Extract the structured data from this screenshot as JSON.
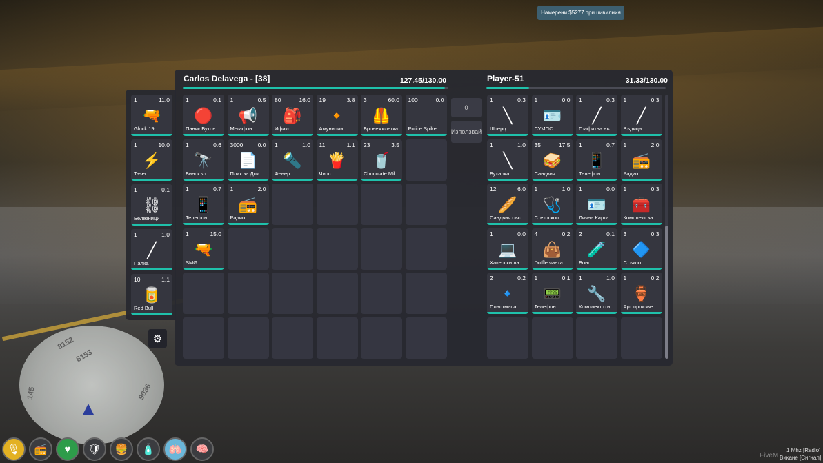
{
  "notification": "Намерени $5277 при цивилния",
  "left_inventory": {
    "title": "Carlos Delavega - [38]",
    "weight": "127.45/130.00",
    "hotbar": [
      {
        "amount": "1",
        "weight": "11.0",
        "label": "Glock 19",
        "icon": "pistol-icon",
        "glyph": "🔫"
      },
      {
        "amount": "1",
        "weight": "10.0",
        "label": "Taser",
        "icon": "taser-icon",
        "glyph": "⚡"
      },
      {
        "amount": "1",
        "weight": "0.1",
        "label": "Белезници",
        "icon": "handcuffs-icon",
        "glyph": "⛓"
      },
      {
        "amount": "1",
        "weight": "1.0",
        "label": "Палка",
        "icon": "baton-icon",
        "glyph": "╱"
      },
      {
        "amount": "10",
        "weight": "1.1",
        "label": "Red Bull",
        "icon": "energy-drink-icon",
        "glyph": "🥫"
      }
    ],
    "rows": [
      [
        {
          "amount": "1",
          "weight": "0.1",
          "label": "Паник Бутон",
          "icon": "panic-button-icon",
          "glyph": "🔴"
        },
        {
          "amount": "1",
          "weight": "0.5",
          "label": "Мегафон",
          "icon": "megaphone-icon",
          "glyph": "📢"
        },
        {
          "amount": "80",
          "weight": "16.0",
          "label": "Ифакс",
          "icon": "ifaks-icon",
          "glyph": "🎒"
        },
        {
          "amount": "19",
          "weight": "3.8",
          "label": "Амуниции",
          "icon": "ammo-icon",
          "glyph": "🔸"
        },
        {
          "amount": "3",
          "weight": "60.0",
          "label": "Бронежилетка",
          "icon": "vest-icon",
          "glyph": "🦺"
        },
        {
          "amount": "100",
          "weight": "0.0",
          "label": "Police Spike S...",
          "icon": "spike-strip-icon",
          "glyph": ""
        }
      ],
      [
        {
          "amount": "1",
          "weight": "0.6",
          "label": "Бинокъл",
          "icon": "binoculars-icon",
          "glyph": "🔭"
        },
        {
          "amount": "3000",
          "weight": "0.0",
          "label": "Плик за Док...",
          "icon": "evidence-bag-icon",
          "glyph": "📄"
        },
        {
          "amount": "1",
          "weight": "1.0",
          "label": "Фенер",
          "icon": "flashlight-icon",
          "glyph": "🔦"
        },
        {
          "amount": "11",
          "weight": "1.1",
          "label": "Чипс",
          "icon": "chips-icon",
          "glyph": "🍟"
        },
        {
          "amount": "23",
          "weight": "3.5",
          "label": "Chocolate Mil...",
          "icon": "milkshake-icon",
          "glyph": "🥤"
        },
        null
      ],
      [
        {
          "amount": "1",
          "weight": "0.7",
          "label": "Телефон",
          "icon": "phone-icon",
          "glyph": "📱"
        },
        {
          "amount": "1",
          "weight": "2.0",
          "label": "Радио",
          "icon": "radio-icon",
          "glyph": "📻"
        },
        null,
        null,
        null,
        null
      ],
      [
        {
          "amount": "1",
          "weight": "15.0",
          "label": "SMG",
          "icon": "smg-icon",
          "glyph": "🔫"
        },
        null,
        null,
        null,
        null,
        null
      ],
      [
        null,
        null,
        null,
        null,
        null,
        null
      ],
      [
        null,
        null,
        null,
        null,
        null,
        null
      ]
    ]
  },
  "middle": {
    "amount_value": "0",
    "use_label": "Използвай"
  },
  "right_inventory": {
    "title": "Player-51",
    "weight": "31.33/130.00",
    "rows": [
      [
        {
          "amount": "1",
          "weight": "0.3",
          "label": "Шперц",
          "icon": "lockpick-icon",
          "glyph": "╲"
        },
        {
          "amount": "1",
          "weight": "0.0",
          "label": "СУМПС",
          "icon": "license-icon",
          "glyph": "🪪"
        },
        {
          "amount": "1",
          "weight": "0.3",
          "label": "Графитна въ...",
          "icon": "graphite-icon",
          "glyph": "╱"
        },
        {
          "amount": "1",
          "weight": "0.3",
          "label": "Въдица",
          "icon": "fishing-rod-icon",
          "glyph": "╱"
        }
      ],
      [
        {
          "amount": "1",
          "weight": "1.0",
          "label": "Бухалка",
          "icon": "bat-icon",
          "glyph": "╲"
        },
        {
          "amount": "35",
          "weight": "17.5",
          "label": "Сандвич",
          "icon": "sandwich-icon",
          "glyph": "🥪"
        },
        {
          "amount": "1",
          "weight": "0.7",
          "label": "Телефон",
          "icon": "phone-icon",
          "glyph": "📱"
        },
        {
          "amount": "1",
          "weight": "2.0",
          "label": "Радио",
          "icon": "radio-icon",
          "glyph": "📻"
        }
      ],
      [
        {
          "amount": "12",
          "weight": "6.0",
          "label": "Сандвич със ...",
          "icon": "baguette-icon",
          "glyph": "🥖"
        },
        {
          "amount": "1",
          "weight": "1.0",
          "label": "Стетоскоп",
          "icon": "stethoscope-icon",
          "glyph": "🩺"
        },
        {
          "amount": "1",
          "weight": "0.0",
          "label": "Лична Карта",
          "icon": "id-card-icon",
          "glyph": "🪪"
        },
        {
          "amount": "1",
          "weight": "0.3",
          "label": "Комплект за ...",
          "icon": "kit-icon",
          "glyph": "🧰"
        }
      ],
      [
        {
          "amount": "1",
          "weight": "0.0",
          "label": "Хакерски ла...",
          "icon": "laptop-icon",
          "glyph": "💻"
        },
        {
          "amount": "4",
          "weight": "0.2",
          "label": "Duffle чанта",
          "icon": "duffle-bag-icon",
          "glyph": "👜"
        },
        {
          "amount": "2",
          "weight": "0.1",
          "label": "Бонг",
          "icon": "bong-icon",
          "glyph": "🧪"
        },
        {
          "amount": "3",
          "weight": "0.3",
          "label": "Стъкло",
          "icon": "glass-icon",
          "glyph": "🔷"
        }
      ],
      [
        {
          "amount": "2",
          "weight": "0.2",
          "label": "Пластмаса",
          "icon": "plastic-icon",
          "glyph": "🔹"
        },
        {
          "amount": "1",
          "weight": "0.1",
          "label": "Телефон",
          "icon": "old-phone-icon",
          "glyph": "📟"
        },
        {
          "amount": "1",
          "weight": "1.0",
          "label": "Комплект с ин...",
          "icon": "tools-icon",
          "glyph": "🔧"
        },
        {
          "amount": "1",
          "weight": "0.2",
          "label": "Арт произве...",
          "icon": "art-icon",
          "glyph": "🏺"
        }
      ],
      [
        null,
        null,
        null,
        null
      ]
    ]
  },
  "minimap": {
    "labels": [
      "8152",
      "8153",
      "9036",
      "145"
    ]
  },
  "hud": [
    {
      "icon": "microphone-icon",
      "glyph": "🎙"
    },
    {
      "icon": "radio-hud-icon",
      "glyph": "📻"
    },
    {
      "icon": "health-icon",
      "glyph": "♥"
    },
    {
      "icon": "armor-icon",
      "glyph": "🛡"
    },
    {
      "icon": "hunger-icon",
      "glyph": "🍔"
    },
    {
      "icon": "thirst-icon",
      "glyph": "🧴"
    },
    {
      "icon": "lungs-icon",
      "glyph": "🫁"
    },
    {
      "icon": "stress-icon",
      "glyph": "🧠"
    }
  ],
  "footer": {
    "radio": "1 Mhz [Radio]",
    "watermark": "FiveM",
    "calling": "Викане [Сигнал]"
  },
  "colors": {
    "accent": "#1fc1ab",
    "panel": "#28292f",
    "slot": "#35363f",
    "notify": "#3d5f70"
  }
}
